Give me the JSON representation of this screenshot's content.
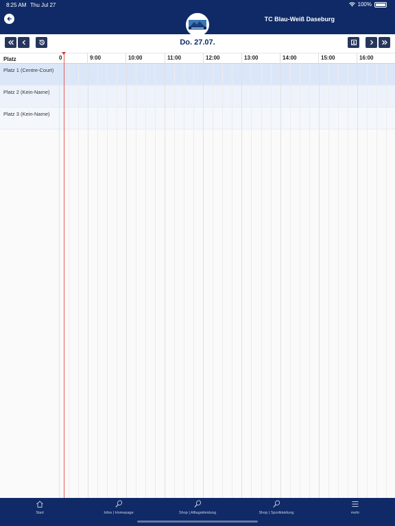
{
  "status_bar": {
    "time": "8:25 AM",
    "date": "Thu Jul 27",
    "battery": "100%"
  },
  "header": {
    "club_name": "TC Blau-Weiß Daseburg"
  },
  "date_nav": {
    "title": "Do. 27.07."
  },
  "grid": {
    "court_header": "Platz",
    "now_label": "0",
    "hours": [
      "9:00",
      "10:00",
      "11:00",
      "12:00",
      "13:00",
      "14:00",
      "15:00",
      "16:00"
    ],
    "courts": [
      "Platz 1 (Centre-Court)",
      "Platz 2 (Kein-Name)",
      "Platz 3 (Kein-Name)"
    ]
  },
  "tabs": [
    {
      "label": "Start",
      "icon": "home-icon"
    },
    {
      "label": "Infos | Homepage",
      "icon": "tennis-racket-icon"
    },
    {
      "label": "Shop | Alltagskleidung",
      "icon": "tennis-racket-icon"
    },
    {
      "label": "Shop | Sportkleidung",
      "icon": "tennis-racket-icon"
    },
    {
      "label": "mehr",
      "icon": "menu-icon"
    }
  ],
  "colors": {
    "brand": "#0f2a66",
    "nav_button": "#26355c",
    "now_line": "#e85a5a",
    "row_selected": "#dbe7f8"
  }
}
